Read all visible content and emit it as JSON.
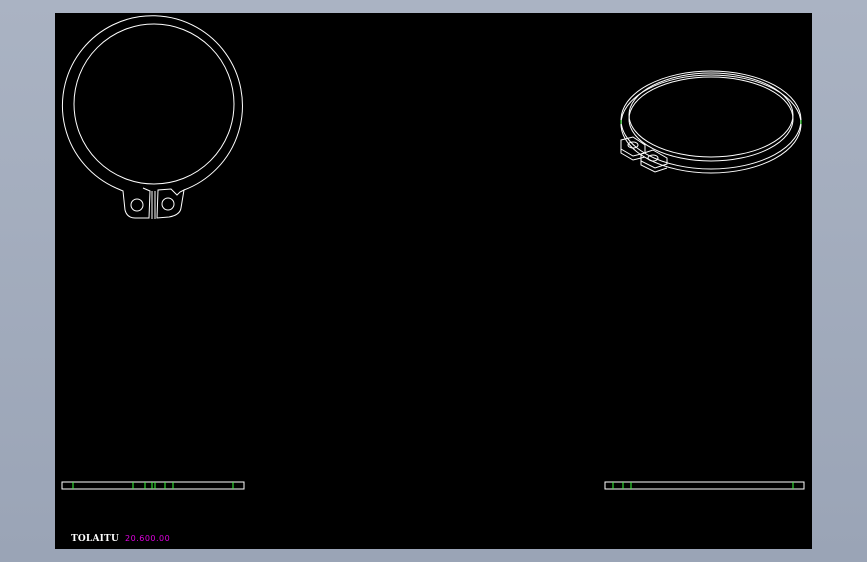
{
  "colors": {
    "background": "#9aa4b6",
    "viewport": "#000000",
    "line": "#ffffff",
    "edge": "#3cff3c",
    "brand_text": "#ffffff",
    "part_text": "#e000e0"
  },
  "drawing": {
    "views": [
      "front-view",
      "isometric-view",
      "side-view-left",
      "side-view-right"
    ]
  },
  "title_block": {
    "brand": "TOLAITU",
    "part_number": "20.600.00"
  }
}
